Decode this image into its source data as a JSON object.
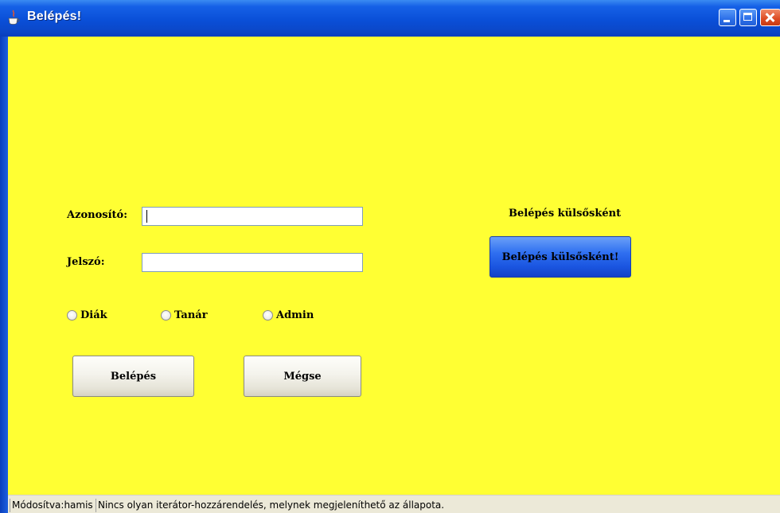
{
  "window": {
    "title": "Belépés!",
    "controls": {
      "minimize": "minimize-icon",
      "maximize": "maximize-icon",
      "close": "close-icon"
    }
  },
  "form": {
    "id_label": "Azonosító:",
    "id_value": "",
    "password_label": "Jelszó:",
    "password_value": "",
    "roles": [
      "Diák",
      "Tanár",
      "Admin"
    ],
    "login_button": "Belépés",
    "cancel_button": "Mégse"
  },
  "external": {
    "heading": "Belépés külsősként",
    "button": "Belépés külsősként!"
  },
  "status": {
    "modified": "Módosítva:hamis",
    "message": "Nincs olyan iterátor-hozzárendelés, melynek megjeleníthető az állapota."
  },
  "colors": {
    "background": "#ffff33",
    "accent_button": "#1a55e0",
    "titlebar": "#0a4fd8"
  }
}
